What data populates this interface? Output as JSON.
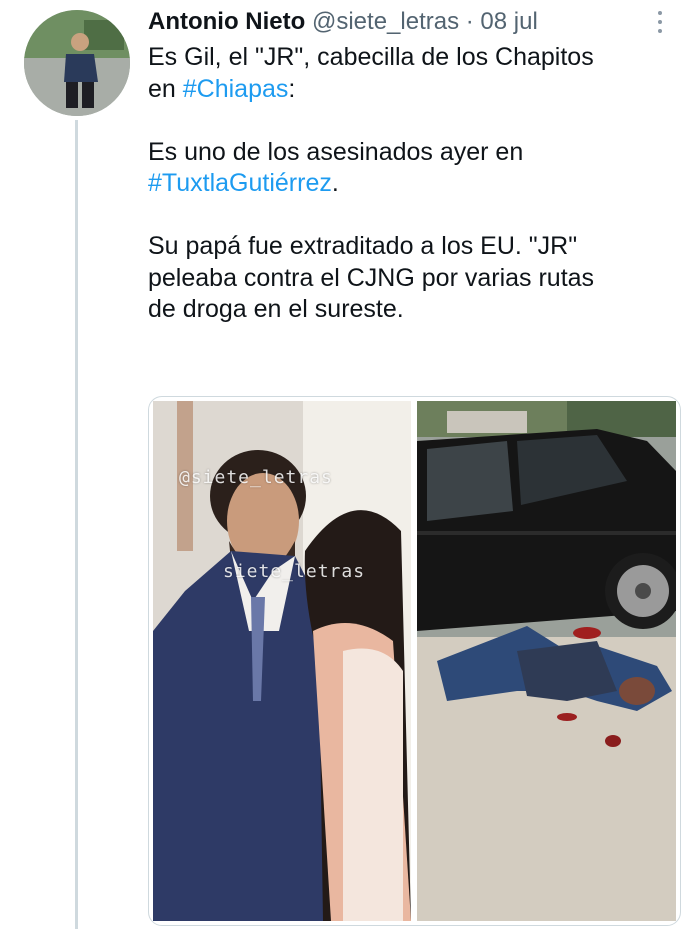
{
  "tweet": {
    "author_name": "Antonio Nieto",
    "author_handle": "@siete_letras",
    "separator": "·",
    "date": "08 jul",
    "paragraphs": [
      {
        "lines": [
          [
            {
              "text": "Es Gil, el \"JR\", cabecilla de los Chapitos"
            }
          ],
          [
            {
              "text": "en "
            },
            {
              "text": "#Chiapas",
              "link": true
            },
            {
              "text": ":"
            }
          ]
        ]
      },
      {
        "lines": [
          [
            {
              "text": "Es uno de los asesinados ayer en"
            }
          ],
          [
            {
              "text": "#TuxtlaGutiérrez",
              "link": true
            },
            {
              "text": "."
            }
          ]
        ]
      },
      {
        "lines": [
          [
            {
              "text": "Su papá fue extraditado a los EU. \"JR\""
            }
          ],
          [
            {
              "text": "peleaba contra el CJNG por varias rutas"
            }
          ],
          [
            {
              "text": "de droga en el sureste."
            }
          ]
        ]
      }
    ]
  },
  "media": {
    "watermark_top": "@siete_letras",
    "watermark_mid": "siete_letras"
  },
  "colors": {
    "link": "#1d9bf0",
    "muted": "#536471",
    "thread_line": "#cfd9de"
  },
  "icons": {
    "more": "more-options-icon"
  }
}
